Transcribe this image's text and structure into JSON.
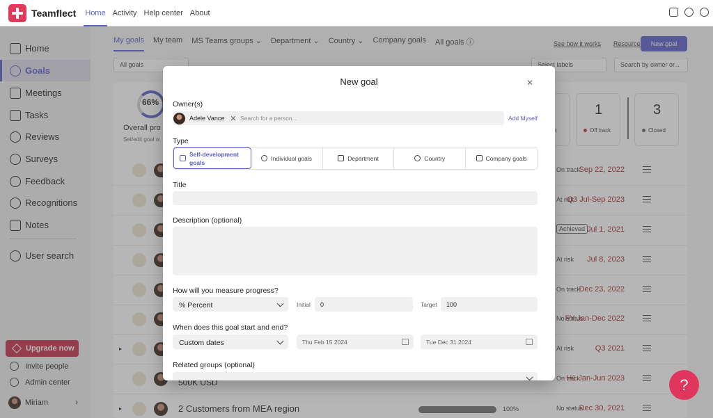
{
  "app": {
    "brand": "Teamflect"
  },
  "topnav": [
    "Home",
    "Activity",
    "Help center",
    "About"
  ],
  "sidebar": {
    "items": [
      "Home",
      "Goals",
      "Meetings",
      "Tasks",
      "Reviews",
      "Surveys",
      "Feedback",
      "Recognitions",
      "Notes",
      "User search"
    ],
    "upgrade_label": "Upgrade now",
    "invite_label": "Invite people",
    "admin_label": "Admin center",
    "user_name": "Miriam"
  },
  "subnav": [
    "My goals",
    "My team",
    "MS Teams groups",
    "Department",
    "Country",
    "Company goals",
    "All goals"
  ],
  "toolbar": {
    "how_label": "See how it works",
    "resources_label": "Resources",
    "new_goal_label": "New goal"
  },
  "filters": {
    "all_goals": "All goals",
    "labels_placeholder": "Select labels",
    "search_placeholder": "Search by owner or..."
  },
  "summary": {
    "progress_pct": "66%",
    "progress_value": 0.66,
    "progress_label": "Overall pro",
    "progress_sub": "Set/edit goal w",
    "off_track_count": "1",
    "off_track_label": "Off track",
    "closed_count": "3",
    "closed_label": "Closed",
    "partial_label": "k"
  },
  "goals": [
    {
      "status": "On track",
      "date": "Sep 22, 2022"
    },
    {
      "status": "At risk",
      "date": "Q3 Jul-Sep 2023"
    },
    {
      "status": "Achieved",
      "date": "Jul 1, 2021"
    },
    {
      "status": "At risk",
      "date": "Jul 8, 2023"
    },
    {
      "status": "On track",
      "date": "Dec 23, 2022"
    },
    {
      "status": "No status",
      "date": "FY Jan-Dec 2022"
    },
    {
      "status": "At risk",
      "date": "Q3 2021"
    },
    {
      "title": "500K USD",
      "status": "On track",
      "date": "H1 Jan-Jun 2023"
    },
    {
      "title": "2 Customers from MEA region",
      "progress_label": "100%",
      "progress_value": 1.0,
      "status": "No status",
      "date": "Dec 30, 2021"
    }
  ],
  "modal": {
    "title": "New goal",
    "owners_label": "Owner(s)",
    "owner_chip": "Adele Vance",
    "owner_search_placeholder": "Search for a person...",
    "add_myself": "Add Myself",
    "type_label": "Type",
    "types": [
      "Self-development goals",
      "Individual goals",
      "Department",
      "Country",
      "Company goals"
    ],
    "title_label": "Title",
    "description_label": "Description (optional)",
    "measure_label": "How will you measure progress?",
    "measure_value": "% Percent",
    "initial_label": "Initial",
    "initial_value": "0",
    "target_label": "Target",
    "target_value": "100",
    "dates_label": "When does this goal start and end?",
    "dates_value": "Custom dates",
    "start_date": "Thu Feb 15 2024",
    "end_date": "Tue Dec 31 2024",
    "related_label": "Related groups (optional)"
  },
  "help_label": "?"
}
